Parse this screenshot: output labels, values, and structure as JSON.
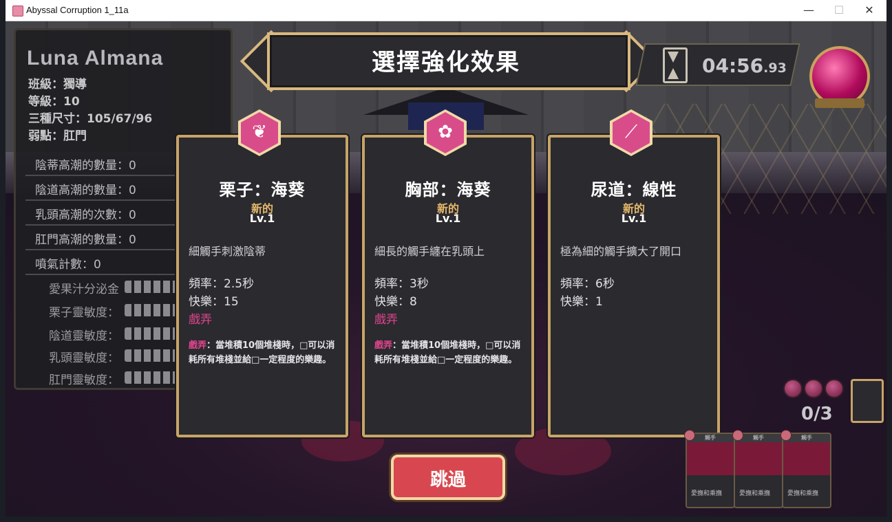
{
  "window": {
    "title": "Abyssal Corruption 1_11a",
    "minimize": "—",
    "maximize": "☐",
    "close": "✕"
  },
  "character": {
    "name": "Luna Almana",
    "class_line": "班級：獨導",
    "level_line": "等級：10",
    "size_line": "三種尺寸：105/67/96",
    "weak_line": "弱點：肛門"
  },
  "stats": [
    "陰蒂高潮的數量：0",
    "陰道高潮的數量：0",
    "乳頭高潮的次數：0",
    "肛門高潮的數量：0",
    "噴氣計數：0"
  ],
  "sensitivity": [
    "愛果汁分泌金",
    "栗子靈敏度：",
    "陰道靈敏度：",
    "乳頭靈敏度：",
    "肛門靈敏度："
  ],
  "banner": {
    "title": "選擇強化效果"
  },
  "timer": {
    "main": "04:56",
    "fraction": ".93"
  },
  "cards": [
    {
      "icon": "tentacle-drop-icon",
      "glyph": "❦",
      "title": "栗子：海葵",
      "new_label": "新的",
      "level": "Lv.1",
      "description": "細觸手刺激陰蒂",
      "frequency": "頻率：2.5秒",
      "pleasure": "快樂：15",
      "tag": "戲弄",
      "note_keyword": "戲弄",
      "note_text": "：當堆積10個堆棧時，□可以消耗所有堆棧並給□一定程度的樂趣。"
    },
    {
      "icon": "tentacle-chest-icon",
      "glyph": "✿",
      "title": "胸部：海葵",
      "new_label": "新的",
      "level": "Lv.1",
      "description": "細長的觸手纏在乳頭上",
      "frequency": "頻率：3秒",
      "pleasure": "快樂：8",
      "tag": "戲弄",
      "note_keyword": "戲弄",
      "note_text": "：當堆積10個堆棧時，□可以消耗所有堆棧並給□一定程度的樂趣。"
    },
    {
      "icon": "linear-tentacle-icon",
      "glyph": "⟋",
      "title": "尿道：線性",
      "new_label": "新的",
      "level": "Lv.1",
      "description": "極為細的觸手擴大了開口",
      "frequency": "頻率：6秒",
      "pleasure": "快樂：1",
      "tag": "",
      "note_keyword": "",
      "note_text": ""
    }
  ],
  "skip_button": {
    "label": "跳過"
  },
  "deck": {
    "count": "0/3"
  },
  "mini_cards": [
    {
      "head": "觸手",
      "label": "愛撫和乘撫"
    },
    {
      "head": "觸手",
      "label": "愛撫和乘撫"
    },
    {
      "head": "觸手",
      "label": "愛撫和乘撫"
    }
  ],
  "colors": {
    "accent_pink": "#e0458d",
    "gold_border": "#c8a468",
    "skip_red": "#d8474f"
  }
}
